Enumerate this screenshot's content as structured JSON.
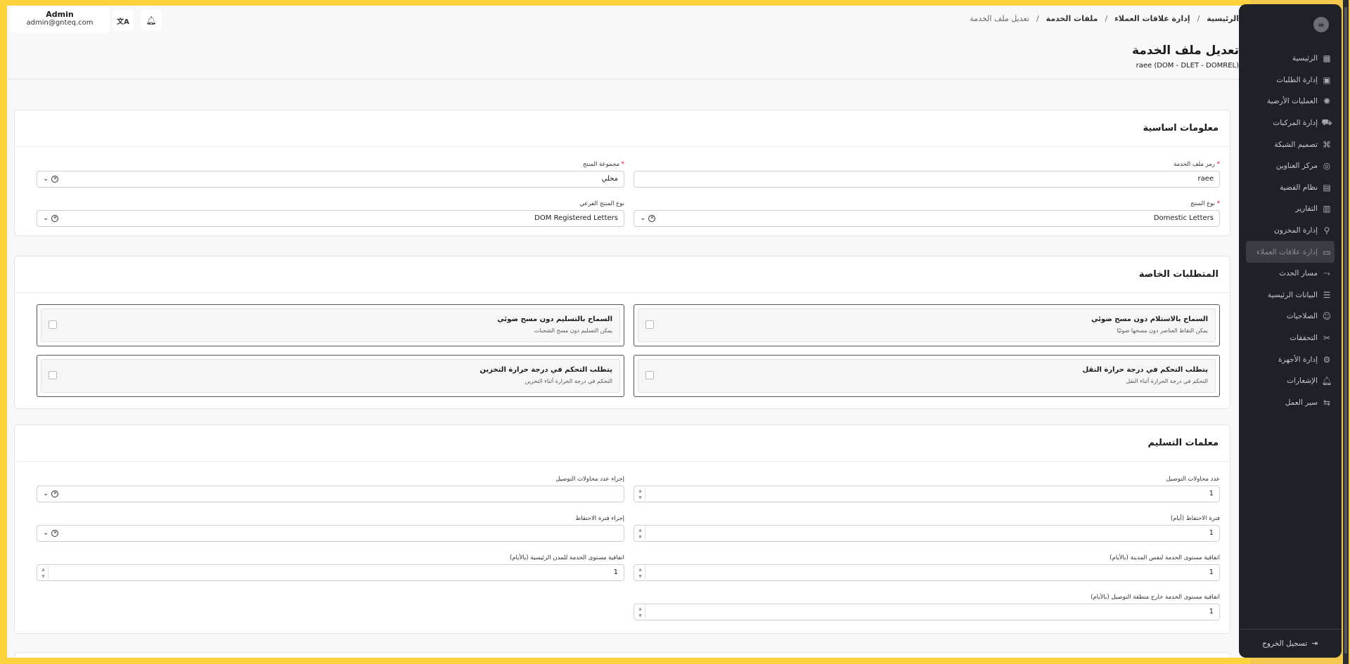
{
  "breadcrumb": {
    "home": "الرئيسية",
    "crm": "إدارة علاقات العملاء",
    "service_files": "ملفات الخدمة",
    "current": "تعديل ملف الخدمة"
  },
  "user": {
    "name": "Admin",
    "email": "admin@gnteq.com"
  },
  "page": {
    "title": "تعديل ملف الخدمة",
    "subtitle": "raee (DOM - DLET - DOMREL)"
  },
  "sidebar": {
    "logo": "∞",
    "items": [
      {
        "label": "الرئيسية",
        "icon": "dashboard-icon"
      },
      {
        "label": "إدارة الطلبات",
        "icon": "orders-icon"
      },
      {
        "label": "العمليات الأرضية",
        "icon": "ground-ops-icon"
      },
      {
        "label": "إدارة المركبات",
        "icon": "truck-icon"
      },
      {
        "label": "تصميم الشبكة",
        "icon": "network-icon"
      },
      {
        "label": "مركز العناوين",
        "icon": "location-icon"
      },
      {
        "label": "نظام القضية",
        "icon": "case-icon"
      },
      {
        "label": "التقارير",
        "icon": "reports-icon"
      },
      {
        "label": "إدارة المخزون",
        "icon": "inventory-icon"
      },
      {
        "label": "إدارة علاقات العملاء",
        "icon": "crm-icon"
      },
      {
        "label": "مسار الحدث",
        "icon": "route-icon"
      },
      {
        "label": "البيانات الرئيسية",
        "icon": "database-icon"
      },
      {
        "label": "الصلاحيات",
        "icon": "users-icon"
      },
      {
        "label": "التحققات",
        "icon": "tools-icon"
      },
      {
        "label": "إدارة الأجهزة",
        "icon": "device-icon"
      },
      {
        "label": "الإشعارات",
        "icon": "bell-icon"
      },
      {
        "label": "سير العمل",
        "icon": "workflow-icon"
      }
    ],
    "logout": "تسجيل الخروج"
  },
  "basic_info": {
    "title": "معلومات اساسية",
    "service_code_label": "رمز ملف الخدمة",
    "service_code_value": "raee",
    "product_group_label": "مجموعة المنتج",
    "product_group_value": "محلي",
    "product_type_label": "نوع المنتج",
    "product_type_value": "Domestic Letters",
    "sub_product_type_label": "نوع المنتج الفرعي",
    "sub_product_type_value": "DOM Registered Letters"
  },
  "special_requirements": {
    "title": "المتطلبات الخاصة",
    "options": [
      {
        "title": "السماح بالاستلام دون مسح ضوئي",
        "desc": "يمكن التقاط العناصر دون مسحها ضوئيًا"
      },
      {
        "title": "السماح بالتسليم دون مسح ضوئي",
        "desc": "يمكن التسليم دون مسح الشحنات"
      },
      {
        "title": "يتطلب التحكم في درجة حرارة النقل",
        "desc": "التحكم في درجة الحرارة أثناء النقل"
      },
      {
        "title": "يتطلب التحكم في درجة حرارة التخزين",
        "desc": "التحكم في درجة الحرارة أثناء التخزين"
      }
    ]
  },
  "delivery_params": {
    "title": "معلمات التسليم",
    "attempts_label": "عدد محاولات التوصيل",
    "attempts_value": "1",
    "attempts_action_label": "إجراء عدد محاولات التوصيل",
    "retention_label": "فترة الاحتفاظ (أيام)",
    "retention_value": "1",
    "retention_action_label": "إجراء فترة الاحتفاظ",
    "sla_same_city_label": "اتفاقية مستوى الخدمة لنفس المدينة (بالأيام)",
    "sla_same_city_value": "1",
    "sla_main_cities_label": "اتفاقية مستوى الخدمة للمدن الرئيسية (بالأيام)",
    "sla_main_cities_value": "1",
    "sla_outside_label": "اتفاقية مستوى الخدمة خارج منطقة التوصيل (بالأيام)",
    "sla_outside_value": "1"
  },
  "icons": {
    "translate": "translate-icon",
    "bell": "bell-icon",
    "clear": "clear-circle-icon",
    "chevron": "chevron-down-icon"
  },
  "colors": {
    "frame": "#fdd23a",
    "sidebar": "#1e2125",
    "required": "#dd0000"
  }
}
